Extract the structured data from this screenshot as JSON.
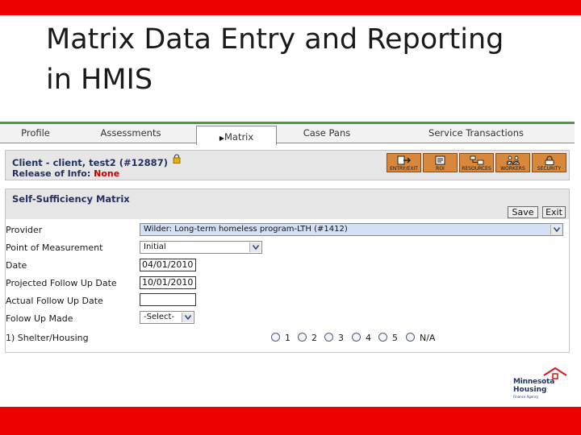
{
  "slide": {
    "title_line1": "Matrix Data Entry and Reporting",
    "title_line2": "in HMIS"
  },
  "tabs": [
    "Profile",
    "Assessments",
    "Matrix",
    "Case Pans",
    "Service Transactions"
  ],
  "client": {
    "name": "Client - client, test2 (#12887)",
    "release_label": "Release of Info:",
    "release_value": "None"
  },
  "toolbar": [
    "ENTRY/EXIT",
    "ROI",
    "RESOURCES",
    "CASE WORKERS",
    "SECURITY"
  ],
  "matrix": {
    "title": "Self-Sufficiency Matrix",
    "save": "Save",
    "exit": "Exit",
    "provider_label": "Provider",
    "provider_value": "Wilder: Long-term homeless program-LTH (#1412)",
    "pom_label": "Point of Measurement",
    "pom_value": "Initial",
    "date_label": "Date",
    "date_value": "04/01/2010",
    "projected_label": "Projected Follow Up Date",
    "projected_value": "10/01/2010",
    "actual_label": "Actual Follow Up Date",
    "actual_value": "",
    "followup_label": "Folow Up Made",
    "followup_value": "-Select-",
    "shelter_label": "1) Shelter/Housing",
    "options": [
      "1",
      "2",
      "3",
      "4",
      "5",
      "N/A"
    ]
  },
  "logo": {
    "line1": "Minnesota",
    "line2": "Housing",
    "tagline": "Finance Agency"
  },
  "colors": {
    "accent_red": "#ee0000",
    "tab_border_green": "#4e9a3c",
    "toolbar_orange": "#d9883b",
    "header_navy": "#24305e",
    "release_red": "#cc0000"
  }
}
